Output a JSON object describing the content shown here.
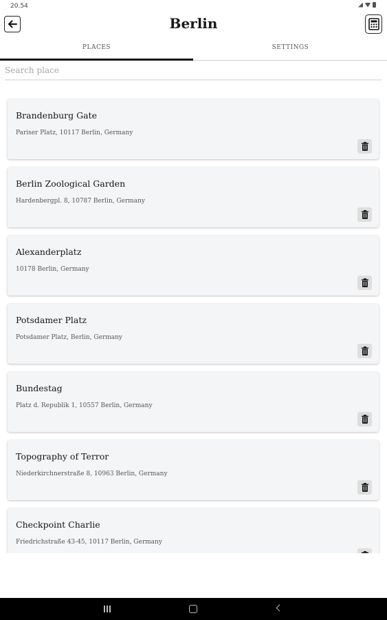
{
  "status_bar": {
    "time": "20.54"
  },
  "header": {
    "title": "Berlin"
  },
  "tabs": [
    {
      "label": "PLACES",
      "selected": true
    },
    {
      "label": "SETTINGS",
      "selected": false
    }
  ],
  "search": {
    "placeholder": "Search place",
    "value": ""
  },
  "places": [
    {
      "name": "Brandenburg Gate",
      "address": "Pariser Platz, 10117 Berlin, Germany"
    },
    {
      "name": "Berlin Zoological Garden",
      "address": "Hardenbergpl. 8, 10787 Berlin, Germany"
    },
    {
      "name": "Alexanderplatz",
      "address": "10178 Berlin, Germany"
    },
    {
      "name": "Potsdamer Platz",
      "address": "Potsdamer Platz, Berlin, Germany"
    },
    {
      "name": "Bundestag",
      "address": "Platz d. Republik 1, 10557 Berlin, Germany"
    },
    {
      "name": "Topography of Terror",
      "address": "Niederkirchnerstraße 8, 10963 Berlin, Germany"
    },
    {
      "name": "Checkpoint Charlie",
      "address": "Friedrichstraße 43-45, 10117 Berlin, Germany"
    }
  ],
  "icons": {
    "back": "arrow-left-icon",
    "calculator": "calculator-icon",
    "delete": "trash-icon"
  }
}
